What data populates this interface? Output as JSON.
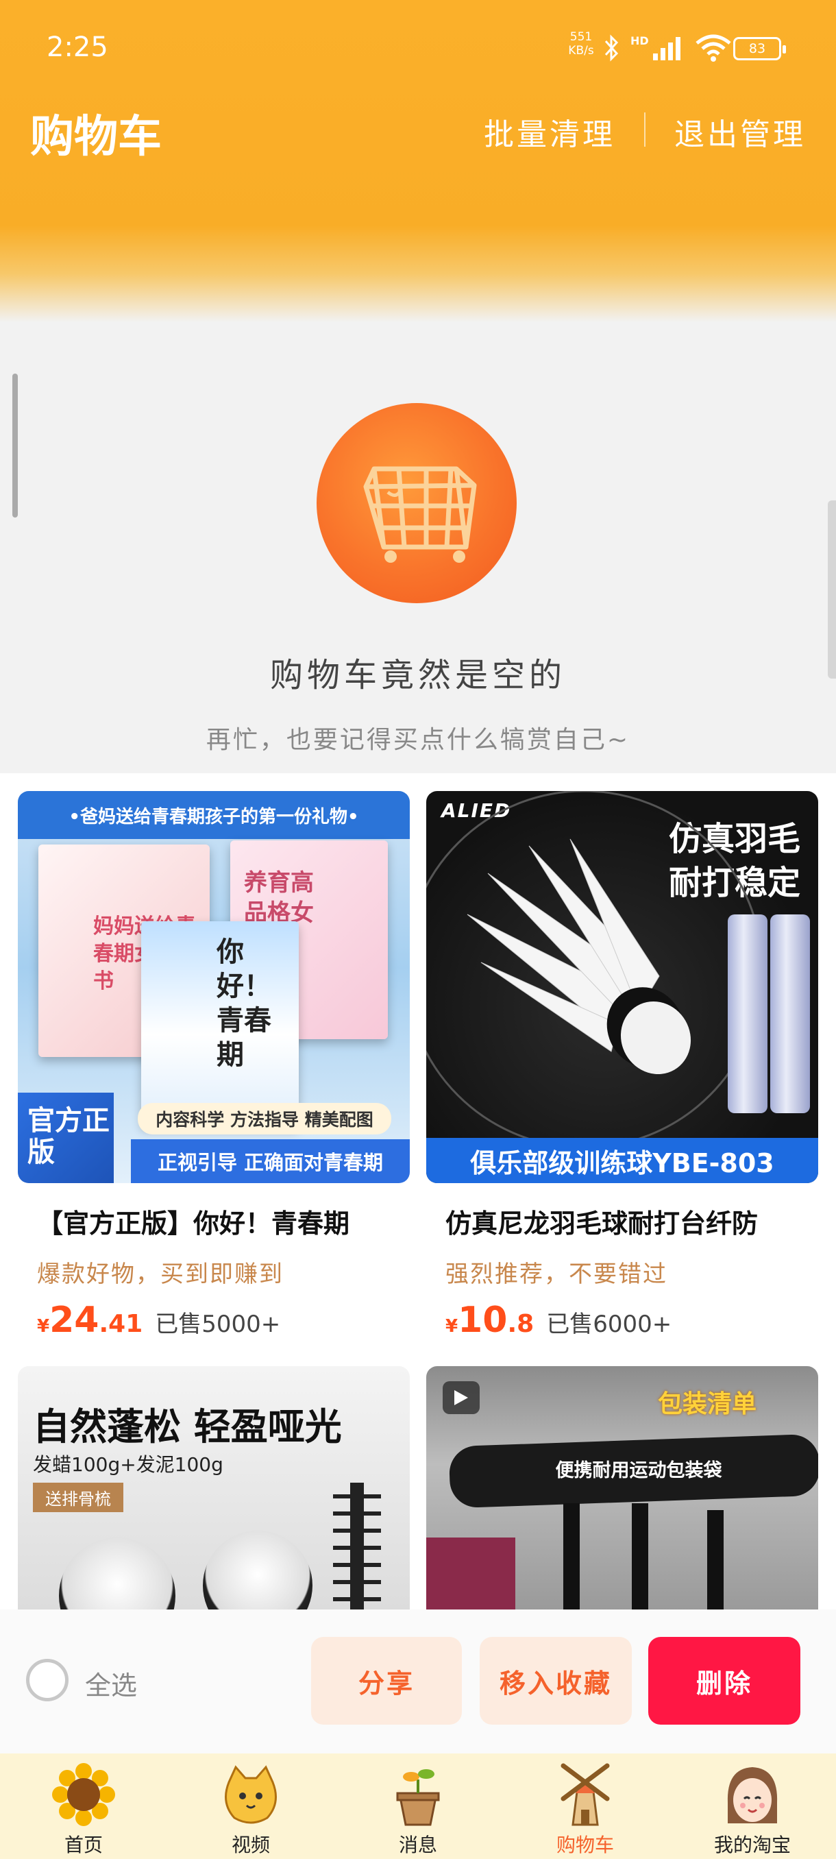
{
  "status_bar": {
    "time": "2:25",
    "net_speed": "551 KB/s",
    "network": "HD",
    "battery": "83"
  },
  "header": {
    "title": "购物车",
    "batch_clean": "批量清理",
    "exit_manage": "退出管理"
  },
  "empty_state": {
    "title": "购物车竟然是空的",
    "subtitle": "再忙，也要记得买点什么犒赏自己~"
  },
  "products": [
    {
      "title": "【官方正版】你好！青春期",
      "tag": "爆款好物，买到即赚到",
      "currency": "¥",
      "price_int": "24",
      "price_dec": ".41",
      "sold": "已售5000+",
      "image": {
        "banner": "•爸妈送给青春期孩子的第一份礼物•",
        "book1": "妈妈送给青春期女儿的书",
        "book2": "养育高品格女孩",
        "book3": "你好！青春期",
        "pill": "内容科学  方法指导  精美配图",
        "badge": "官方正版",
        "strip": "正视引导  正确面对青春期"
      }
    },
    {
      "title": "仿真尼龙羽毛球耐打台纤防",
      "tag": "强烈推荐，不要错过",
      "currency": "¥",
      "price_int": "10",
      "price_dec": ".8",
      "sold": "已售6000+",
      "image": {
        "brand": "ALIED",
        "headline1": "仿真羽毛",
        "headline2": "耐打稳定",
        "strip": "俱乐部级训练球YBE-803"
      }
    },
    {
      "image": {
        "t1": "自然蓬松 轻盈哑光",
        "t2": "发蜡100g+发泥100g",
        "t3": "送排骨梳"
      }
    },
    {
      "image": {
        "label": "包装清单",
        "bag_label": "便携耐用运动包装袋"
      }
    }
  ],
  "action_bar": {
    "select_all": "全选",
    "share": "分享",
    "move_to_fav": "移入收藏",
    "delete": "删除"
  },
  "tabs": [
    {
      "label": "首页",
      "icon": "sunflower-icon"
    },
    {
      "label": "视频",
      "icon": "cat-icon"
    },
    {
      "label": "消息",
      "icon": "sprout-icon"
    },
    {
      "label": "购物车",
      "icon": "windmill-icon",
      "active": true
    },
    {
      "label": "我的淘宝",
      "icon": "avatar-icon"
    }
  ]
}
